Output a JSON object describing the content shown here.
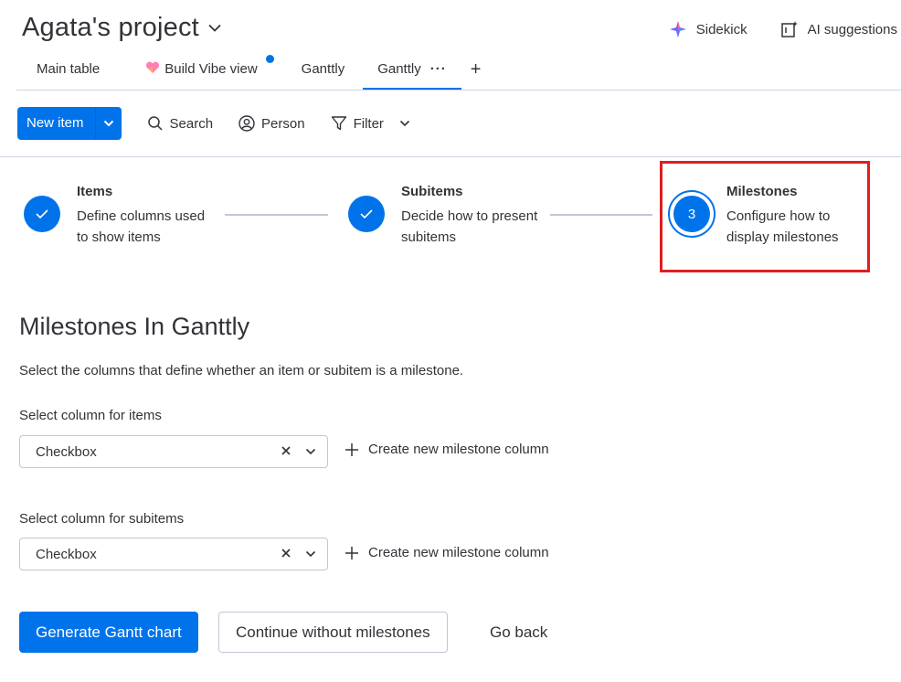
{
  "header": {
    "title": "Agata's project",
    "sidekick_label": "Sidekick",
    "ai_label": "AI suggestions"
  },
  "tabs": [
    {
      "label": "Main table"
    },
    {
      "label": "Build Vibe view"
    },
    {
      "label": "Ganttly"
    },
    {
      "label": "Ganttly",
      "active": true
    }
  ],
  "toolbar": {
    "new_item_label": "New item",
    "search_label": "Search",
    "person_label": "Person",
    "filter_label": "Filter"
  },
  "steps": [
    {
      "title": "Items",
      "desc": "Define columns used to show items",
      "status": "done"
    },
    {
      "title": "Subitems",
      "desc": "Decide how to present subitems",
      "status": "done"
    },
    {
      "title": "Milestones",
      "desc": "Configure how to display milestones",
      "status": "current",
      "number": "3"
    }
  ],
  "section": {
    "title": "Milestones In Ganttly",
    "description": "Select the columns that define whether an item or subitem is a milestone."
  },
  "items_field": {
    "label": "Select column for items",
    "value": "Checkbox",
    "create_label": "Create new milestone column"
  },
  "subitems_field": {
    "label": "Select column for subitems",
    "value": "Checkbox",
    "create_label": "Create new milestone column"
  },
  "actions": {
    "primary": "Generate Gantt chart",
    "secondary": "Continue without milestones",
    "tertiary": "Go back"
  },
  "colors": {
    "accent": "#0073ea",
    "highlight": "#e01e1e",
    "text": "#323338"
  }
}
